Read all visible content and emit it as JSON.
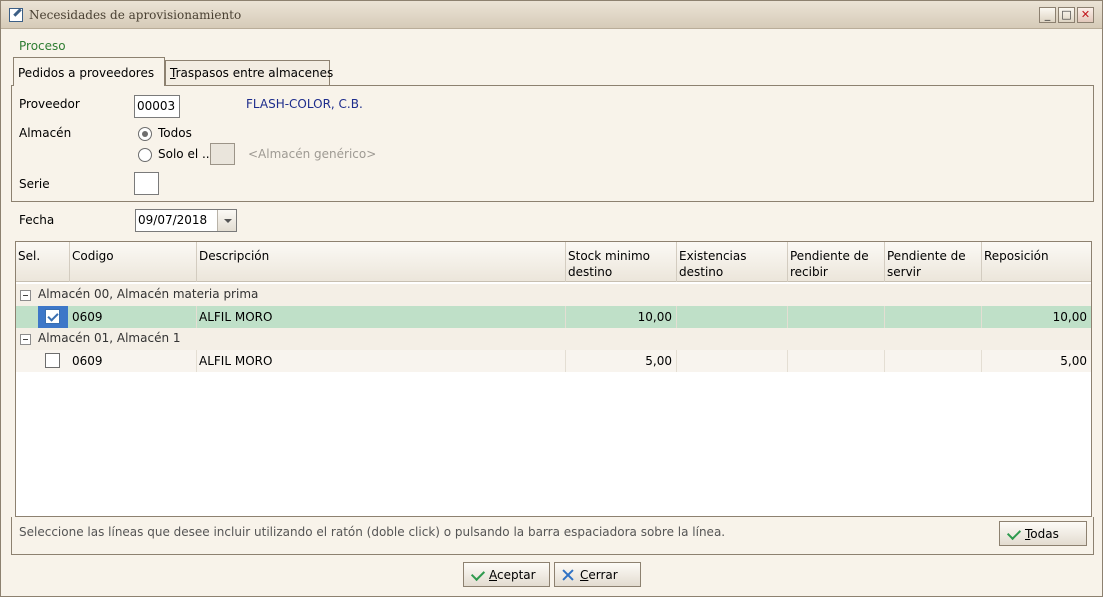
{
  "window": {
    "title": "Necesidades de aprovisionamiento",
    "minimize": "_",
    "maximize": "□",
    "close": "✕"
  },
  "proceso_label": "Proceso",
  "tabs": [
    {
      "label": "Pedidos a proveedores",
      "active": true
    },
    {
      "label_underlined": "T",
      "label_rest": "raspasos entre almacenes",
      "active": false
    }
  ],
  "form": {
    "proveedor_label": "Proveedor",
    "proveedor_value": "00003",
    "proveedor_name": "FLASH-COLOR, C.B.",
    "almacen_label": "Almacén",
    "radio_todos": "Todos",
    "radio_solo": "Solo el ..",
    "almacen_generico": "<Almacén genérico>",
    "serie_label": "Serie",
    "serie_value": "",
    "fecha_label": "Fecha",
    "fecha_value": "09/07/2018"
  },
  "grid": {
    "columns": [
      "Sel.",
      "Codigo",
      "Descripción",
      "Stock minimo destino",
      "Existencias destino",
      "Pendiente de recibir",
      "Pendiente de servir",
      "Reposición"
    ],
    "col_stock": [
      "Stock minimo",
      "destino"
    ],
    "col_exist": [
      "Existencias",
      "destino"
    ],
    "col_pend_rec": [
      "Pendiente de",
      "recibir"
    ],
    "col_pend_serv": [
      "Pendiente de",
      "servir"
    ],
    "groups": [
      {
        "label": "Almacén 00, Almacén materia prima",
        "rows": [
          {
            "selected": true,
            "codigo": "0609",
            "descripcion": "ALFIL MORO",
            "stock_minimo": "10,00",
            "existencias": "",
            "pend_recibir": "",
            "pend_servir": "",
            "reposicion": "10,00"
          }
        ]
      },
      {
        "label": "Almacén 01, Almacén 1",
        "rows": [
          {
            "selected": false,
            "codigo": "0609",
            "descripcion": "ALFIL MORO",
            "stock_minimo": "5,00",
            "existencias": "",
            "pend_recibir": "",
            "pend_servir": "",
            "reposicion": "5,00"
          }
        ]
      }
    ]
  },
  "info_text": "Seleccione las líneas que desee incluir utilizando el ratón (doble click) o pulsando la barra espaciadora sobre la línea.",
  "buttons": {
    "todas_ul": "T",
    "todas_rest": "odas",
    "aceptar_ul": "A",
    "aceptar_rest": "ceptar",
    "cerrar_ul": "C",
    "cerrar_rest": "errar"
  },
  "colors": {
    "selected_row": "#bfe0c8",
    "proceso": "#2e7d32",
    "provider_name": "#1d2c8c",
    "check_green": "#2e9a4e",
    "close_blue": "#2f72c4"
  }
}
